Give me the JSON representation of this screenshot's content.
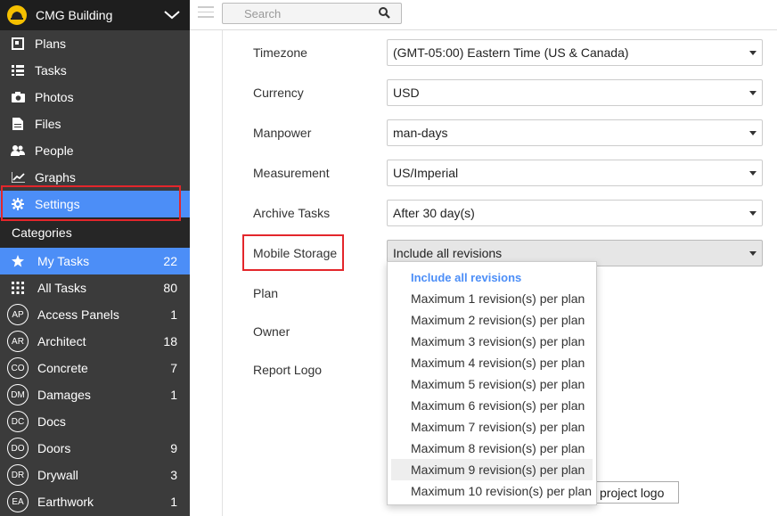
{
  "sidebar": {
    "project_name": "CMG Building",
    "nav": [
      {
        "label": "Plans",
        "icon": "plans-icon"
      },
      {
        "label": "Tasks",
        "icon": "tasks-list-icon"
      },
      {
        "label": "Photos",
        "icon": "camera-icon"
      },
      {
        "label": "Files",
        "icon": "file-icon"
      },
      {
        "label": "People",
        "icon": "people-icon"
      },
      {
        "label": "Graphs",
        "icon": "line-chart-icon"
      },
      {
        "label": "Settings",
        "icon": "gear-icon",
        "active": true
      }
    ],
    "categories_header": "Categories",
    "categories": [
      {
        "label": "My Tasks",
        "count": "22",
        "icon": "star-icon",
        "active": true
      },
      {
        "label": "All Tasks",
        "count": "80",
        "icon": "grid-icon"
      },
      {
        "label": "Access Panels",
        "count": "1",
        "abbr": "AP"
      },
      {
        "label": "Architect",
        "count": "18",
        "abbr": "AR"
      },
      {
        "label": "Concrete",
        "count": "7",
        "abbr": "CO"
      },
      {
        "label": "Damages",
        "count": "1",
        "abbr": "DM"
      },
      {
        "label": "Docs",
        "count": "",
        "abbr": "DC"
      },
      {
        "label": "Doors",
        "count": "9",
        "abbr": "DO"
      },
      {
        "label": "Drywall",
        "count": "3",
        "abbr": "DR"
      },
      {
        "label": "Earthwork",
        "count": "1",
        "abbr": "EA"
      }
    ]
  },
  "topbar": {
    "search_placeholder": "Search"
  },
  "settings": {
    "fields": [
      {
        "label": "Timezone",
        "value": "(GMT-05:00) Eastern Time (US & Canada)"
      },
      {
        "label": "Currency",
        "value": "USD"
      },
      {
        "label": "Manpower",
        "value": "man-days"
      },
      {
        "label": "Measurement",
        "value": "US/Imperial"
      },
      {
        "label": "Archive Tasks",
        "value": "After 30 day(s)"
      },
      {
        "label": "Mobile Storage",
        "value": "Include all revisions"
      }
    ],
    "other_labels": {
      "plan": "Plan",
      "owner": "Owner",
      "report_logo": "Report Logo"
    },
    "logo_button_label": "project logo"
  },
  "mobile_storage_options": [
    "Include all revisions",
    "Maximum 1 revision(s) per plan",
    "Maximum 2 revision(s) per plan",
    "Maximum 3 revision(s) per plan",
    "Maximum 4 revision(s) per plan",
    "Maximum 5 revision(s) per plan",
    "Maximum 6 revision(s) per plan",
    "Maximum 7 revision(s) per plan",
    "Maximum 8 revision(s) per plan",
    "Maximum 9 revision(s) per plan",
    "Maximum 10 revision(s) per plan"
  ],
  "colors": {
    "accent": "#4c8ef7",
    "highlight_box": "#e3262b",
    "sidebar_bg": "#3b3b3b"
  }
}
